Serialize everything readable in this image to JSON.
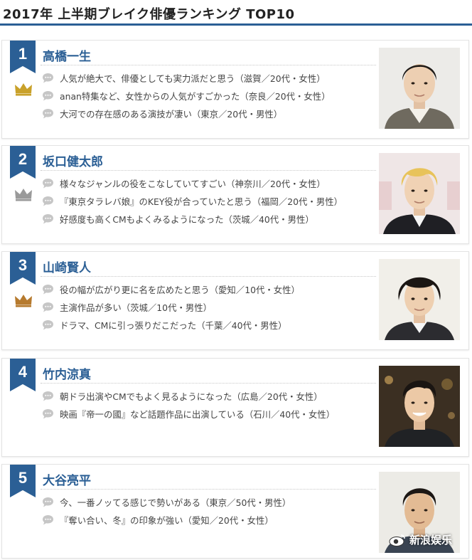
{
  "page": {
    "title": "2017年 上半期ブレイク俳優ランキング TOP10"
  },
  "colors": {
    "accent": "#2b5f95",
    "gold": "#c9a12a",
    "silver": "#9a9a9a",
    "bronze": "#b67a2e"
  },
  "ranking": [
    {
      "rank": "1",
      "name": "高橋一生",
      "crown": "gold-crown-icon",
      "comments": [
        "人気が絶大で、俳優としても実力派だと思う（滋賀／20代・女性）",
        "anan特集など、女性からの人気がすごかった（奈良／20代・女性）",
        "大河での存在感のある演技が凄い（東京／20代・男性）"
      ]
    },
    {
      "rank": "2",
      "name": "坂口健太郎",
      "crown": "silver-crown-icon",
      "comments": [
        "様々なジャンルの役をこなしていてすごい（神奈川／20代・女性）",
        "『東京タラレバ娘』のKEY役が合っていたと思う（福岡／20代・男性）",
        "好感度も高くCMもよくみるようになった（茨城／40代・男性）"
      ]
    },
    {
      "rank": "3",
      "name": "山崎賢人",
      "crown": "bronze-crown-icon",
      "comments": [
        "役の幅が広がり更に名を広めたと思う（愛知／10代・女性）",
        "主演作品が多い（茨城／10代・男性）",
        "ドラマ、CMに引っ張りだこだった（千葉／40代・男性）"
      ]
    },
    {
      "rank": "4",
      "name": "竹内涼真",
      "crown": "",
      "comments": [
        "朝ドラ出演やCMでもよく見るようになった（広島／20代・女性）",
        "映画『帝一の國』など話題作品に出演している（石川／40代・女性）"
      ]
    },
    {
      "rank": "5",
      "name": "大谷亮平",
      "crown": "",
      "comments": [
        "今、一番ノッてる感じで勢いがある（東京／50代・男性）",
        "『奪い合い、冬』の印象が強い（愛知／20代・女性）"
      ]
    }
  ],
  "watermark": {
    "text": "新浪娱乐"
  }
}
